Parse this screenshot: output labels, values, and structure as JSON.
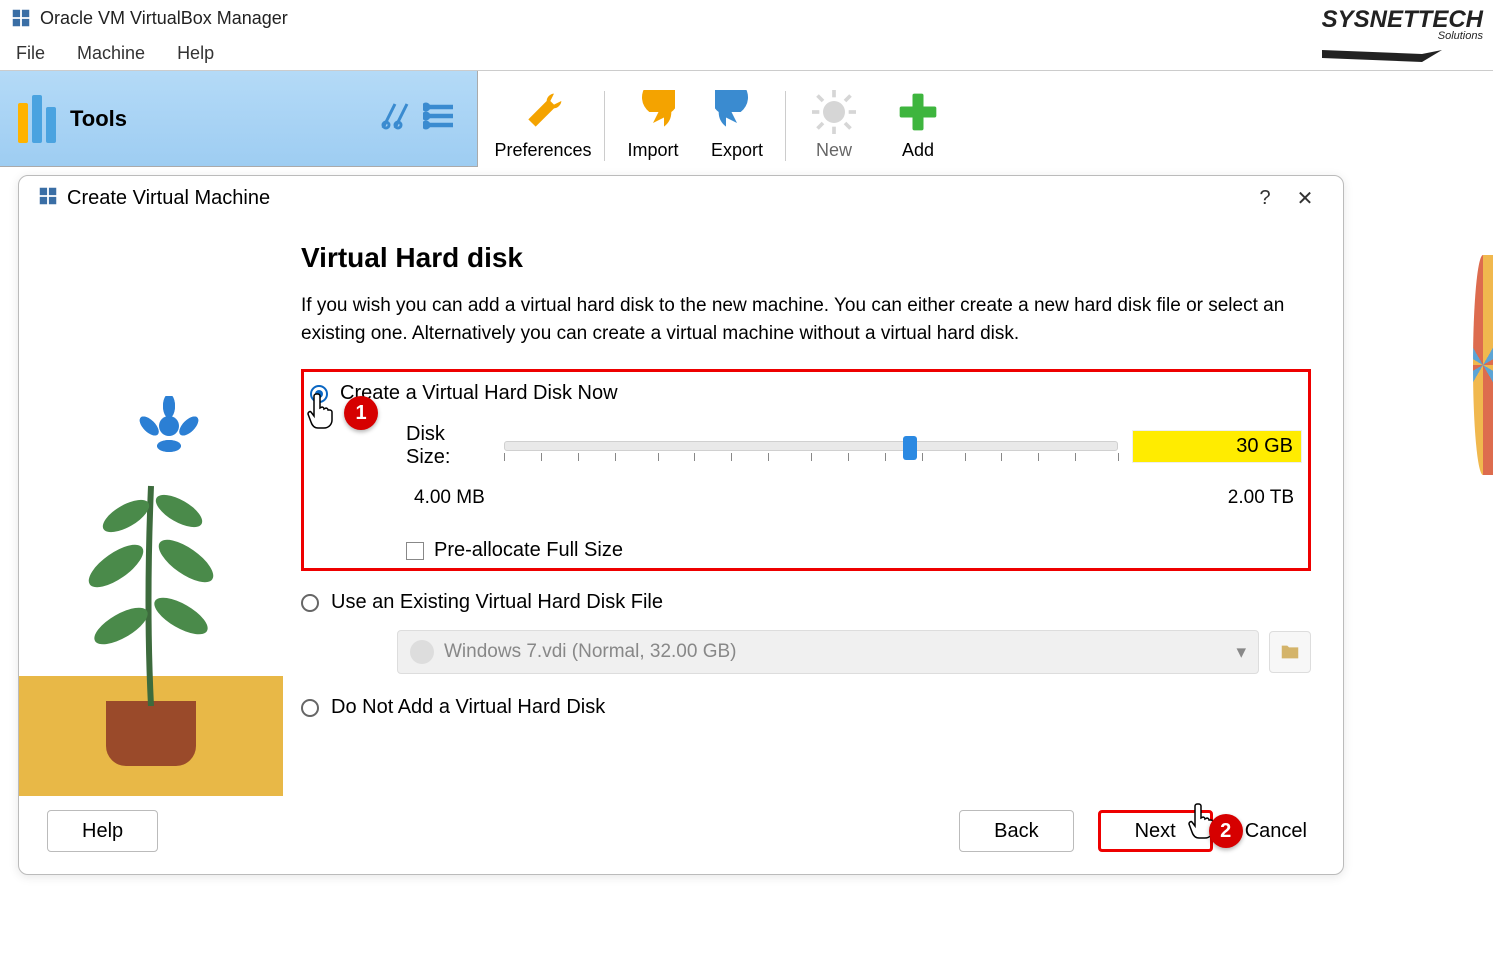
{
  "app": {
    "title": "Oracle VM VirtualBox Manager"
  },
  "menu": {
    "file": "File",
    "machine": "Machine",
    "help": "Help"
  },
  "tools": {
    "label": "Tools"
  },
  "toolbar": {
    "preferences": "Preferences",
    "import": "Import",
    "export": "Export",
    "new": "New",
    "add": "Add"
  },
  "dialog": {
    "title": "Create Virtual Machine",
    "help_glyph": "?",
    "close_glyph": "✕",
    "page_title": "Virtual Hard disk",
    "description": "If you wish you can add a virtual hard disk to the new machine. You can either create a new hard disk file or select an existing one. Alternatively you can create a virtual machine without a virtual hard disk.",
    "opt_create": "Create a Virtual Hard Disk Now",
    "disk_size_label": "Disk Size:",
    "disk_size_value": "30 GB",
    "slider_min": "4.00 MB",
    "slider_max": "2.00 TB",
    "preallocate": "Pre-allocate Full Size",
    "opt_existing": "Use an Existing Virtual Hard Disk File",
    "existing_value": "Windows 7.vdi (Normal, 32.00 GB)",
    "opt_none": "Do Not Add a Virtual Hard Disk",
    "btn_help": "Help",
    "btn_back": "Back",
    "btn_next": "Next",
    "btn_cancel": "Cancel"
  },
  "annotations": {
    "badge1": "1",
    "badge2": "2"
  },
  "watermark": {
    "brand": "SYSNETTECH",
    "sub": "Solutions"
  }
}
